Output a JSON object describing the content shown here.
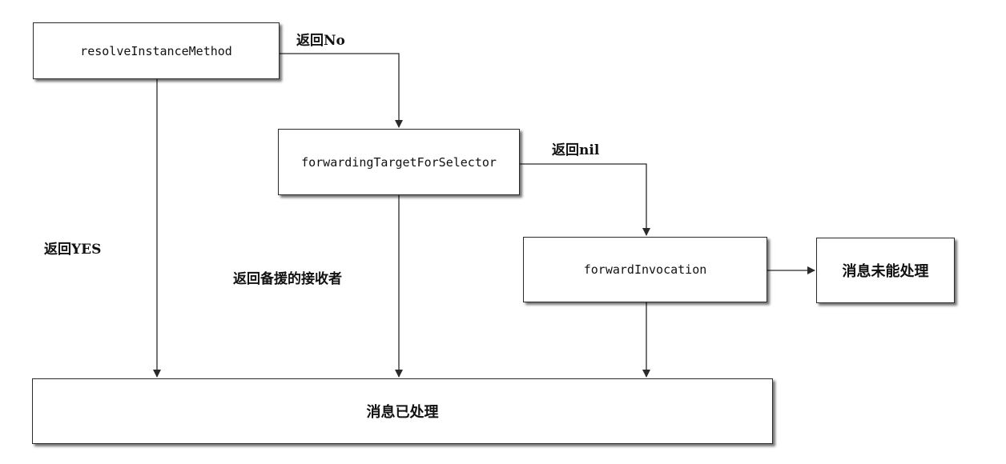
{
  "nodes": {
    "resolve": "resolveInstanceMethod",
    "forwarding_target": "forwardingTargetForSelector",
    "forward_invocation": "forwardInvocation",
    "unhandled": "消息未能处理",
    "handled": "消息已处理"
  },
  "edges": {
    "return_no": "返回No",
    "return_nil": "返回nil",
    "return_yes": "返回YES",
    "return_backup_receiver": "返回备援的接收者"
  },
  "colors": {
    "stroke": "#2a2a2a",
    "text": "#111111"
  }
}
